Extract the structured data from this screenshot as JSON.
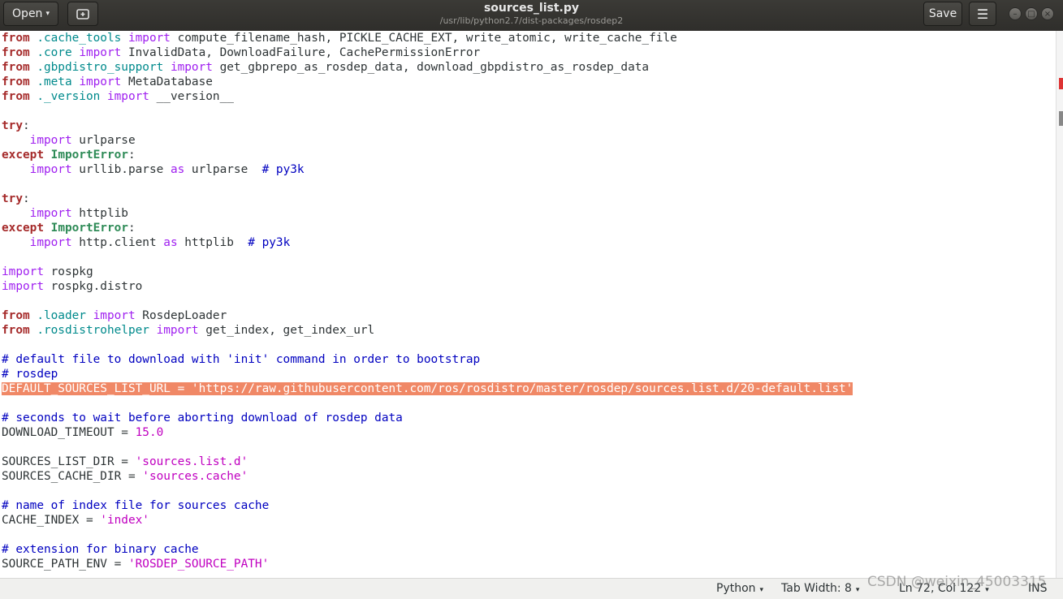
{
  "toolbar": {
    "open_label": "Open",
    "open_arrow": "▾",
    "newtab_icon": "new-tab-icon",
    "title": "sources_list.py",
    "subtitle": "/usr/lib/python2.7/dist-packages/rosdep2",
    "save_label": "Save",
    "menu_icon": "☰",
    "minimize_glyph": "–",
    "maximize_glyph": "□",
    "close_glyph": "×"
  },
  "code": {
    "l1": {
      "a": "from",
      "b": " .cache_tools ",
      "c": "import",
      "d": " compute_filename_hash, PICKLE_CACHE_EXT, write_atomic, write_cache_file"
    },
    "l2": {
      "a": "from",
      "b": " .core ",
      "c": "import",
      "d": " InvalidData, DownloadFailure, CachePermissionError"
    },
    "l3": {
      "a": "from",
      "b": " .gbpdistro_support ",
      "c": "import",
      "d": " get_gbprepo_as_rosdep_data, download_gbpdistro_as_rosdep_data"
    },
    "l4": {
      "a": "from",
      "b": " .meta ",
      "c": "import",
      "d": " MetaDatabase"
    },
    "l5": {
      "a": "from",
      "b": " ._version ",
      "c": "import",
      "d": " __version__"
    },
    "l7": {
      "a": "try",
      ":": ":"
    },
    "l8": {
      "a": "    ",
      "b": "import",
      "c": " urlparse"
    },
    "l9": {
      "a": "except",
      "b": " ",
      "c": "ImportError",
      "d": ":"
    },
    "l10": {
      "a": "    ",
      "b": "import",
      "c": " urllib.parse ",
      "d": "as",
      "e": " urlparse  ",
      "f": "# py3k"
    },
    "l12": {
      "a": "try",
      ":": ":"
    },
    "l13": {
      "a": "    ",
      "b": "import",
      "c": " httplib"
    },
    "l14": {
      "a": "except",
      "b": " ",
      "c": "ImportError",
      "d": ":"
    },
    "l15": {
      "a": "    ",
      "b": "import",
      "c": " http.client ",
      "d": "as",
      "e": " httplib  ",
      "f": "# py3k"
    },
    "l17": {
      "a": "import",
      "b": " rospkg"
    },
    "l18": {
      "a": "import",
      "b": " rospkg.distro"
    },
    "l20": {
      "a": "from",
      "b": " .loader ",
      "c": "import",
      "d": " RosdepLoader"
    },
    "l21": {
      "a": "from",
      "b": " .rosdistrohelper ",
      "c": "import",
      "d": " get_index, get_index_url"
    },
    "l23": "# default file to download with 'init' command in order to bootstrap",
    "l24": "# rosdep",
    "l25": "DEFAULT_SOURCES_LIST_URL = 'https://raw.githubusercontent.com/ros/rosdistro/master/rosdep/sources.list.d/20-default.list'",
    "l27": "# seconds to wait before aborting download of rosdep data",
    "l28": {
      "a": "DOWNLOAD_TIMEOUT = ",
      "b": "15.0"
    },
    "l30": {
      "a": "SOURCES_LIST_DIR = ",
      "b": "'sources.list.d'"
    },
    "l31": {
      "a": "SOURCES_CACHE_DIR = ",
      "b": "'sources.cache'"
    },
    "l33": "# name of index file for sources cache",
    "l34": {
      "a": "CACHE_INDEX = ",
      "b": "'index'"
    },
    "l36": "# extension for binary cache",
    "l37": {
      "a": "SOURCE_PATH_ENV = ",
      "b": "'ROSDEP_SOURCE_PATH'"
    }
  },
  "status": {
    "language": "Python",
    "tab_width": "Tab Width: 8",
    "position": "Ln 72, Col 122",
    "mode": "INS",
    "arrow": "▾"
  },
  "watermark": "CSDN @weixin_45003315",
  "colors": {
    "highlight": "#f08866",
    "keyword": "#a52a2a",
    "import": "#a020f0",
    "comment": "#0000c0",
    "string": "#c000c0"
  }
}
